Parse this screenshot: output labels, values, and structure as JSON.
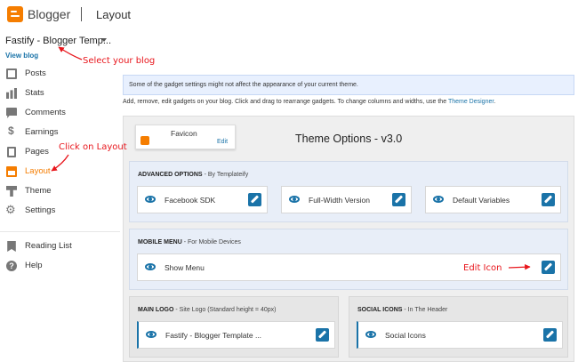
{
  "app": {
    "brand": "Blogger",
    "page_title": "Layout"
  },
  "blog": {
    "name": "Fastify - Blogger Temp...",
    "view_blog": "View blog"
  },
  "sidebar": {
    "items": [
      {
        "label": "Posts",
        "icon": "posts-icon"
      },
      {
        "label": "Stats",
        "icon": "stats-icon"
      },
      {
        "label": "Comments",
        "icon": "comments-icon"
      },
      {
        "label": "Earnings",
        "icon": "earnings-icon"
      },
      {
        "label": "Pages",
        "icon": "pages-icon"
      },
      {
        "label": "Layout",
        "icon": "layout-icon",
        "active": true
      },
      {
        "label": "Theme",
        "icon": "theme-icon"
      },
      {
        "label": "Settings",
        "icon": "settings-icon"
      },
      {
        "label": "Reading List",
        "icon": "reading-list-icon"
      },
      {
        "label": "Help",
        "icon": "help-icon"
      }
    ]
  },
  "annotations": {
    "select_blog": "Select your blog",
    "click_layout": "Click on Layout",
    "edit_icon": "Edit Icon"
  },
  "main": {
    "info": "Some of the gadget settings might not affect the appearance of your current theme.",
    "help_text": "Add, remove, edit gadgets on your blog. Click and drag to rearrange gadgets. To change columns and widths, use the",
    "help_link": "Theme Designer",
    "help_end": ".",
    "favicon": {
      "title": "Favicon",
      "edit": "Edit"
    },
    "theme_title": "Theme Options - v3.0",
    "advanced": {
      "title": "ADVANCED OPTIONS",
      "subtitle": "- By Templateify",
      "gadgets": [
        "Facebook SDK",
        "Full-Width Version",
        "Default Variables"
      ]
    },
    "mobile": {
      "title": "MOBILE MENU",
      "subtitle": "- For Mobile Devices",
      "gadgets": [
        "Show Menu"
      ]
    },
    "main_logo": {
      "title": "MAIN LOGO",
      "subtitle": "- Site Logo (Standard height = 40px)",
      "gadgets": [
        "Fastify - Blogger Template ..."
      ]
    },
    "social": {
      "title": "SOCIAL ICONS",
      "subtitle": "- In The Header",
      "gadgets": [
        "Social Icons"
      ]
    }
  },
  "colors": {
    "accent": "#f57d00",
    "link": "#1a73a8",
    "annotation": "#e8161c"
  }
}
